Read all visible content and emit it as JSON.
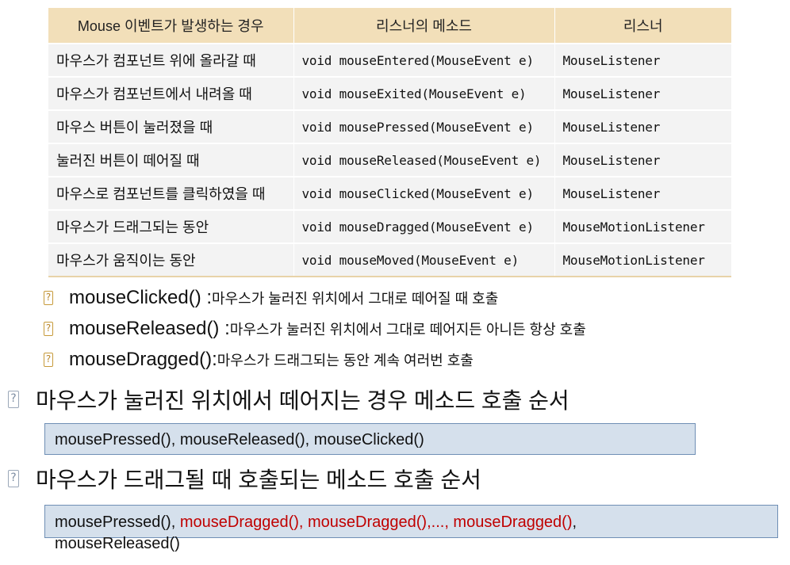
{
  "table": {
    "headers": [
      "Mouse 이벤트가 발생하는 경우",
      "리스너의 메소드",
      "리스너"
    ],
    "rows": [
      [
        "마우스가 컴포넌트 위에 올라갈 때",
        "void mouseEntered(MouseEvent e)",
        "MouseListener"
      ],
      [
        "마우스가 컴포넌트에서 내려올 때",
        "void mouseExited(MouseEvent e)",
        "MouseListener"
      ],
      [
        "마우스 버튼이 눌러졌을 때",
        "void mousePressed(MouseEvent e)",
        "MouseListener"
      ],
      [
        "눌러진 버튼이 떼어질 때",
        "void mouseReleased(MouseEvent e)",
        "MouseListener"
      ],
      [
        "마우스로 컴포넌트를 클릭하였을 때",
        "void mouseClicked(MouseEvent e)",
        "MouseListener"
      ],
      [
        "마우스가 드래그되는 동안",
        "void mouseDragged(MouseEvent e)",
        "MouseMotionListener"
      ],
      [
        "마우스가 움직이는 동안",
        "void mouseMoved(MouseEvent e)",
        "MouseMotionListener"
      ]
    ]
  },
  "icons": {
    "bullet": "?",
    "bullet_semantic": "question-box-icon"
  },
  "colors": {
    "header_bg": "#f2dfb9",
    "row_bg": "#f3f3f3",
    "box_bg": "#d5e0ec",
    "box_border": "#6f8fb5",
    "highlight": "#c00000"
  },
  "notes": [
    {
      "method": "mouseClicked() : ",
      "desc": "마우스가 눌러진 위치에서 그대로 떼어질 때 호출"
    },
    {
      "method": "mouseReleased() : ",
      "desc": "마우스가 눌러진 위치에서 그대로 떼어지든 아니든 항상 호출"
    },
    {
      "method": "mouseDragged(): ",
      "desc": "마우스가 드래그되는 동안 계속 여러번 호출"
    }
  ],
  "section1": {
    "heading": "마우스가 눌러진 위치에서 떼어지는 경우 메소드 호출 순서",
    "sequence": "mousePressed(), mouseReleased(), mouseClicked()"
  },
  "section2": {
    "heading": "마우스가 드래그될 때 호출되는 메소드 호출 순서",
    "seq_start": "mousePressed(), ",
    "seq_dragged": "mouseDragged(), mouseDragged(),..., mouseDragged()",
    "seq_comma": ",",
    "seq_end": "mouseReleased()"
  }
}
